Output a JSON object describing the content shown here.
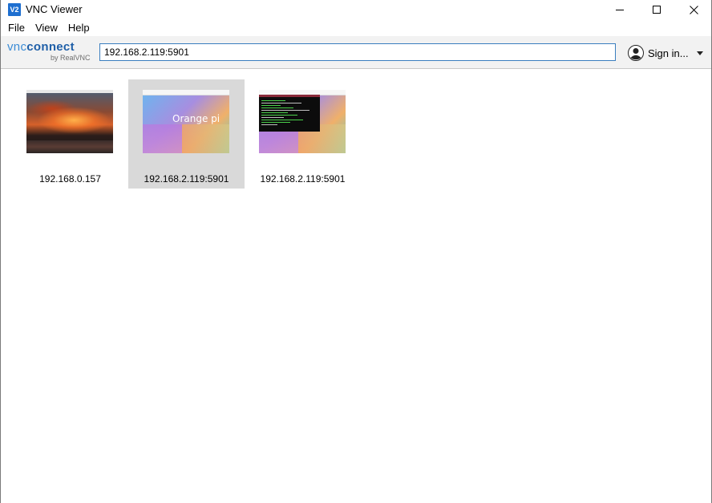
{
  "window": {
    "title": "VNC Viewer",
    "app_icon_text": "V2"
  },
  "menu": {
    "items": [
      "File",
      "View",
      "Help"
    ]
  },
  "toolbar": {
    "logo_vnc": "vnc",
    "logo_connect": "connect",
    "logo_sub": "by RealVNC",
    "address_value": "192.168.2.119:5901",
    "signin_label": "Sign in..."
  },
  "connections": [
    {
      "label": "192.168.0.157",
      "thumbnail": "sunset-desktop"
    },
    {
      "label": "192.168.2.119:5901",
      "thumbnail": "orange-pi-desktop",
      "thumb_text": "Orange pi",
      "selected": true
    },
    {
      "label": "192.168.2.119:5901",
      "thumbnail": "terminal-desktop"
    }
  ],
  "icons": {
    "minimize": "minimize-icon",
    "maximize": "maximize-icon",
    "close": "close-icon",
    "user": "user-icon",
    "dropdown": "chevron-down-icon"
  },
  "colors": {
    "accent": "#3a7ebf",
    "selection": "#d9d9d9",
    "toolbar_bg": "#f2f2f2"
  }
}
